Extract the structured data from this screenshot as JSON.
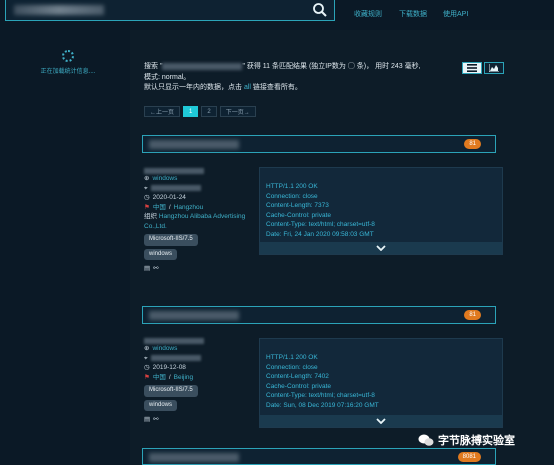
{
  "header": {
    "links": [
      "收藏规则",
      "下载数据",
      "使用API"
    ]
  },
  "sidebar": {
    "loading_text": "正在加载统计信息...."
  },
  "summary": {
    "line1_prefix": "搜索 \"",
    "line1_suffix": "\" 获得 11 条匹配结果 (独立IP数为 ◯ 条)， 用时 243 毫秒,",
    "line2": "模式: normal。",
    "line3_prefix": "默认只显示一年内的数据，点击 ",
    "line3_link": "all",
    "line3_suffix": " 链接查看所有。"
  },
  "pagination": {
    "prev": "←上一页",
    "pages": [
      "1",
      "2"
    ],
    "next": "下一页→"
  },
  "results": [
    {
      "port": "81",
      "os": "windows",
      "date": "2020-01-24",
      "country": "中国",
      "city": "Hangzhou",
      "org_label": "组织",
      "org": "Hangzhou Alibaba Advertising Co.,Ltd.",
      "server_tag": "Microsoft-IIS/7.5",
      "os_tag": "windows",
      "http": [
        "HTTP/1.1 200 OK",
        "Connection: close",
        "Content-Length: 7373",
        "Cache-Control: private",
        "Content-Type: text/html; charset=utf-8",
        "Date: Fri, 24 Jan 2020 09:58:03 GMT"
      ]
    },
    {
      "port": "81",
      "os": "windows",
      "date": "2019-12-08",
      "country": "中国",
      "city": "Beijing",
      "server_tag": "Microsoft-IIS/7.5",
      "os_tag": "windows",
      "http": [
        "HTTP/1.1 200 OK",
        "Connection: close",
        "Content-Length: 7402",
        "Cache-Control: private",
        "Content-Type: text/html; charset=utf-8",
        "Date: Sun, 08 Dec 2019 07:16:20 GMT"
      ]
    },
    {
      "port": "8081"
    }
  ],
  "watermark": "字节脉搏实验室"
}
